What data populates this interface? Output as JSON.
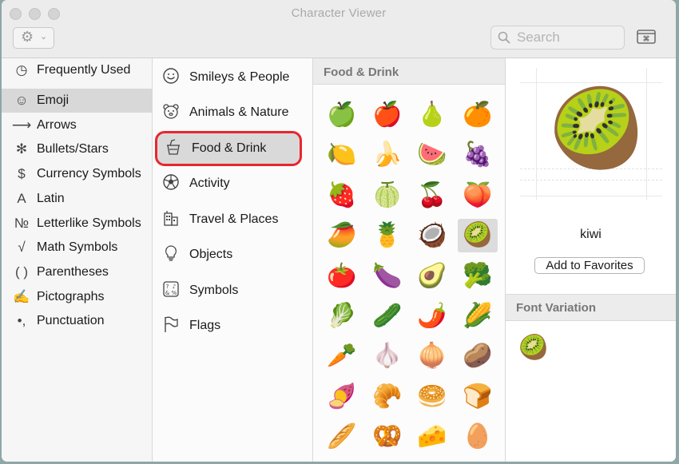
{
  "window": {
    "title": "Character Viewer"
  },
  "toolbar": {
    "search_placeholder": "Search"
  },
  "categories": [
    {
      "icon": "clock-icon",
      "glyph": "◷",
      "label": "Frequently Used"
    },
    {
      "icon": "smiley-icon",
      "glyph": "☺",
      "label": "Emoji",
      "selected": true
    },
    {
      "icon": "arrow-icon",
      "glyph": "⟶",
      "label": "Arrows"
    },
    {
      "icon": "asterisk-icon",
      "glyph": "✻",
      "label": "Bullets/Stars"
    },
    {
      "icon": "dollar-icon",
      "glyph": "$",
      "label": "Currency Symbols"
    },
    {
      "icon": "latin-a-icon",
      "glyph": "A",
      "label": "Latin"
    },
    {
      "icon": "numero-icon",
      "glyph": "№",
      "label": "Letterlike Symbols"
    },
    {
      "icon": "sqrt-icon",
      "glyph": "√",
      "label": "Math Symbols"
    },
    {
      "icon": "parentheses-icon",
      "glyph": "( )",
      "label": "Parentheses"
    },
    {
      "icon": "writing-hand-icon",
      "glyph": "✍",
      "label": "Pictographs"
    },
    {
      "icon": "punctuation-icon",
      "glyph": "•,",
      "label": "Punctuation"
    }
  ],
  "subcategories": [
    {
      "icon": "smiley-outline-icon",
      "label": "Smileys & People"
    },
    {
      "icon": "bear-outline-icon",
      "label": "Animals & Nature"
    },
    {
      "icon": "cup-cake-outline-icon",
      "label": "Food & Drink",
      "selected": true
    },
    {
      "icon": "soccer-ball-outline-icon",
      "label": "Activity"
    },
    {
      "icon": "building-outline-icon",
      "label": "Travel & Places"
    },
    {
      "icon": "lightbulb-outline-icon",
      "label": "Objects"
    },
    {
      "icon": "symbols-outline-icon",
      "label": "Symbols"
    },
    {
      "icon": "flag-outline-icon",
      "label": "Flags"
    }
  ],
  "grid": {
    "header": "Food & Drink",
    "selected_index": 15,
    "chars": [
      "🍏",
      "🍎",
      "🍐",
      "🍊",
      "🍋",
      "🍌",
      "🍉",
      "🍇",
      "🍓",
      "🍈",
      "🍒",
      "🍑",
      "🥭",
      "🍍",
      "🥥",
      "🥝",
      "🍅",
      "🍆",
      "🥑",
      "🥦",
      "🥬",
      "🥒",
      "🌶️",
      "🌽",
      "🥕",
      "🧄",
      "🧅",
      "🥔",
      "🍠",
      "🥐",
      "🥯",
      "🍞",
      "🥖",
      "🥨",
      "🧀",
      "🥚"
    ]
  },
  "detail": {
    "glyph": "🥝",
    "name": "kiwi",
    "add_favorites_label": "Add to Favorites",
    "font_variation_header": "Font Variation",
    "variations": [
      "🥝"
    ]
  },
  "colors": {
    "highlight_ring": "#e8262e",
    "selected_row": "#d8d8d8"
  }
}
